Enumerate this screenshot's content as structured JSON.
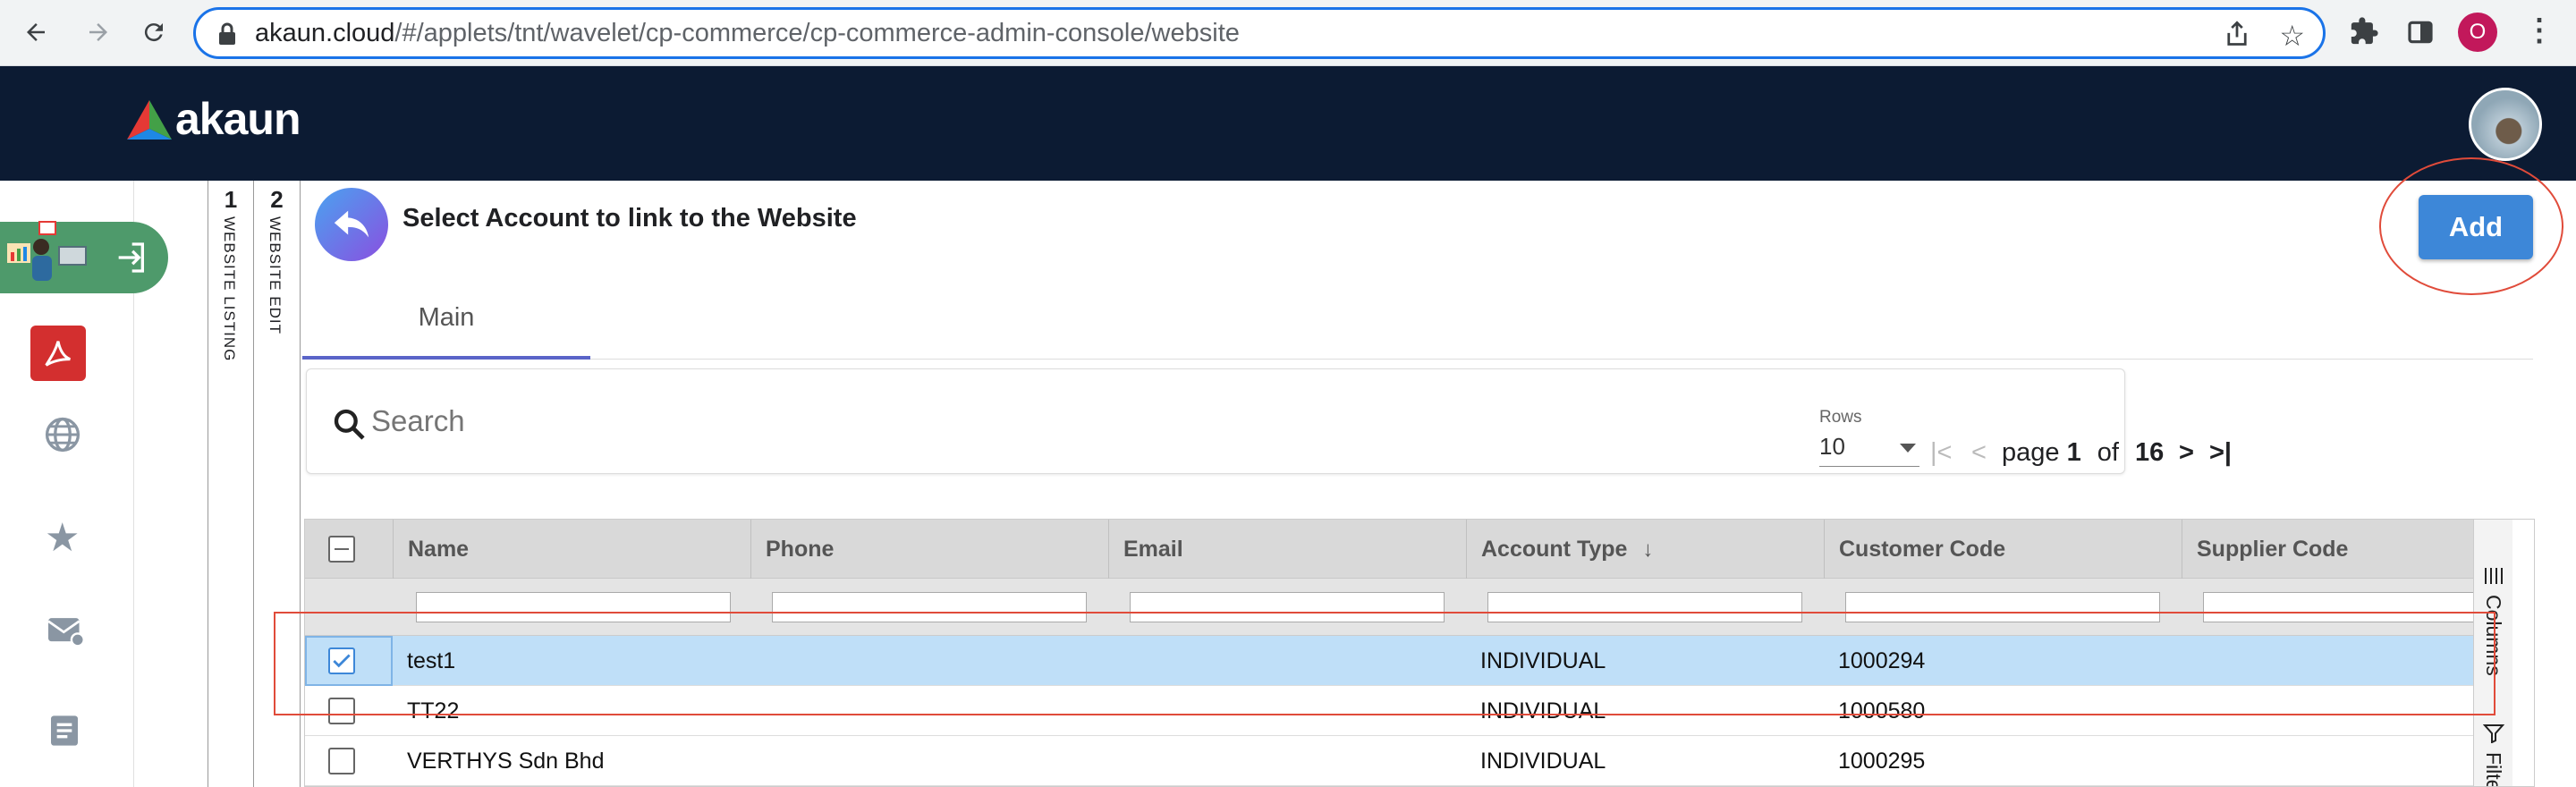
{
  "browser": {
    "url_host": "akaun.cloud",
    "url_path": "/#/applets/tnt/wavelet/cp-commerce/cp-commerce-admin-console/website",
    "profile_initial": "O"
  },
  "app": {
    "logo_text": "akaun"
  },
  "steps": [
    {
      "number": "1",
      "label": "WEBSITE LISTING"
    },
    {
      "number": "2",
      "label": "WEBSITE EDIT"
    }
  ],
  "page": {
    "title": "Select Account to link to the Website",
    "add_label": "Add",
    "tab_main": "Main"
  },
  "search": {
    "placeholder": "Search"
  },
  "pagination": {
    "rows_label": "Rows",
    "rows_value": "10",
    "page_word": "page",
    "current_page": "1",
    "of_word": "of",
    "total_pages": "16"
  },
  "table": {
    "columns": [
      "Name",
      "Phone",
      "Email",
      "Account Type",
      "Customer Code",
      "Supplier Code"
    ],
    "sort_column": "Account Type",
    "rows": [
      {
        "name": "test1",
        "phone": "",
        "email": "",
        "account_type": "INDIVIDUAL",
        "customer_code": "1000294",
        "supplier_code": "",
        "selected": true
      },
      {
        "name": "TT22",
        "phone": "",
        "email": "",
        "account_type": "INDIVIDUAL",
        "customer_code": "1000580",
        "supplier_code": "",
        "selected": false
      },
      {
        "name": "VERTHYS Sdn Bhd",
        "phone": "",
        "email": "",
        "account_type": "INDIVIDUAL",
        "customer_code": "1000295",
        "supplier_code": "",
        "selected": false
      }
    ],
    "side_panel": [
      "Columns",
      "Filters"
    ]
  },
  "colors": {
    "header_bg": "#0c1b33",
    "accent": "#3d87d8",
    "selected_row": "#bfdff8",
    "annotation": "#e04b3a",
    "sidebar_active": "#4e9a6b"
  }
}
